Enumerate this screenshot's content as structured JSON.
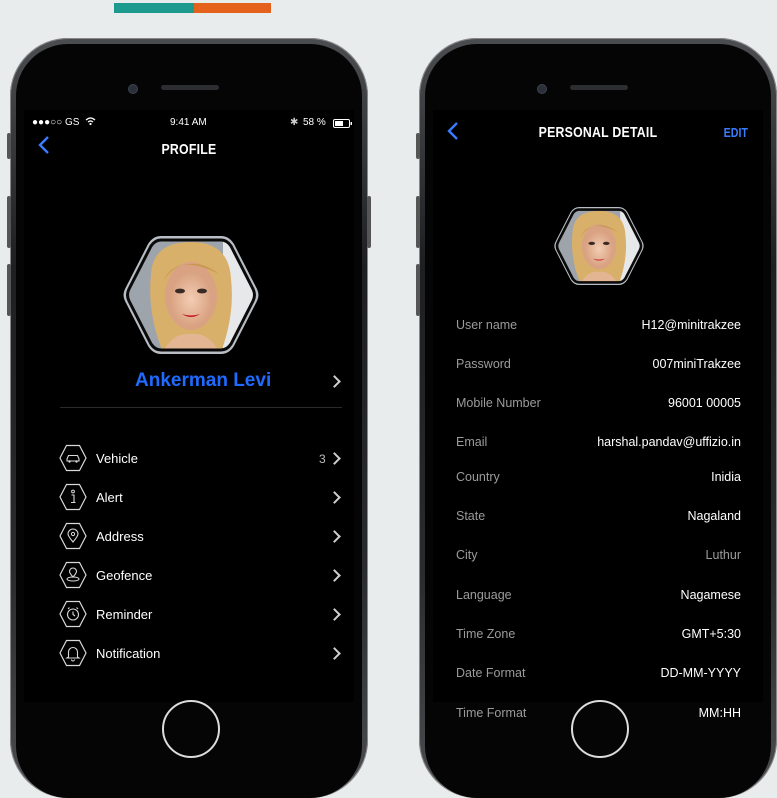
{
  "accent_colors": {
    "teal": "#1d9a8d",
    "orange": "#e5621c",
    "blue": "#1f6bff"
  },
  "profile_screen": {
    "status": {
      "carrier": "●●●○○ GS",
      "time": "9:41 AM",
      "battery": "58 %"
    },
    "title": "PROFILE",
    "user_name": "Ankerman Levi",
    "menu": [
      {
        "label": "Vehicle",
        "icon": "car-icon",
        "count": "3"
      },
      {
        "label": "Alert",
        "icon": "info-icon",
        "count": ""
      },
      {
        "label": "Address",
        "icon": "location-pin-icon",
        "count": ""
      },
      {
        "label": "Geofence",
        "icon": "geofence-icon",
        "count": ""
      },
      {
        "label": "Reminder",
        "icon": "alarm-clock-icon",
        "count": ""
      },
      {
        "label": "Notification",
        "icon": "bell-icon",
        "count": ""
      }
    ]
  },
  "detail_screen": {
    "title": "PERSONAL DETAIL",
    "edit_label": "EDIT",
    "fields": [
      {
        "label": "User name",
        "value": "H12@minitrakzee"
      },
      {
        "label": "Password",
        "value": "007miniTrakzee"
      },
      {
        "label": "Mobile Number",
        "value": "96001 00005"
      },
      {
        "label": "Email",
        "value": "harshal.pandav@uffizio.in"
      },
      {
        "label": "Country",
        "value": "Inidia"
      },
      {
        "label": "State",
        "value": "Nagaland"
      },
      {
        "label": "City",
        "value": "Luthur"
      },
      {
        "label": "Language",
        "value": "Nagamese"
      },
      {
        "label": "Time Zone",
        "value": "GMT+5:30"
      },
      {
        "label": "Date Format",
        "value": "DD-MM-YYYY"
      },
      {
        "label": "Time Format",
        "value": "MM:HH"
      }
    ]
  }
}
